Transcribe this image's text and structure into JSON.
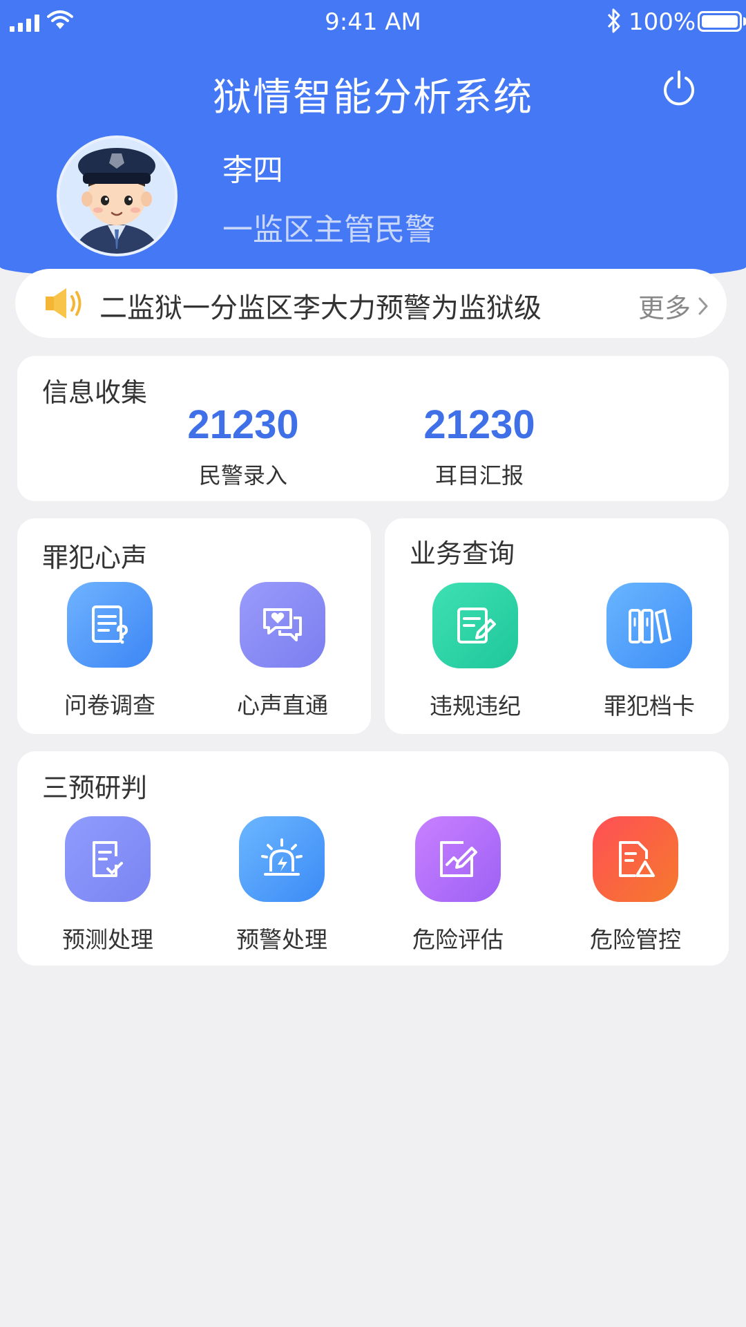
{
  "status_bar": {
    "time": "9:41 AM",
    "battery": "100%"
  },
  "header": {
    "title": "狱情智能分析系统"
  },
  "user": {
    "name": "李四",
    "role": "一监区主管民警"
  },
  "notice": {
    "text": "二监狱一分监区李大力预警为监狱级",
    "more": "更多"
  },
  "info_collection": {
    "title": "信息收集",
    "stats": [
      {
        "value": "21230",
        "label": "民警录入"
      },
      {
        "value": "21230",
        "label": "耳目汇报"
      }
    ]
  },
  "criminal_voice": {
    "title": "罪犯心声",
    "items": [
      {
        "label": "问卷调查"
      },
      {
        "label": "心声直通"
      }
    ]
  },
  "business_query": {
    "title": "业务查询",
    "items": [
      {
        "label": "违规违纪"
      },
      {
        "label": "罪犯档卡"
      }
    ]
  },
  "three_predictions": {
    "title": "三预研判",
    "items": [
      {
        "label": "预测处理"
      },
      {
        "label": "预警处理"
      },
      {
        "label": "危险评估"
      },
      {
        "label": "危险管控"
      }
    ]
  },
  "colors": {
    "primary": "#4578f5",
    "stat_value": "#3f70e8",
    "background": "#f0eff1"
  }
}
